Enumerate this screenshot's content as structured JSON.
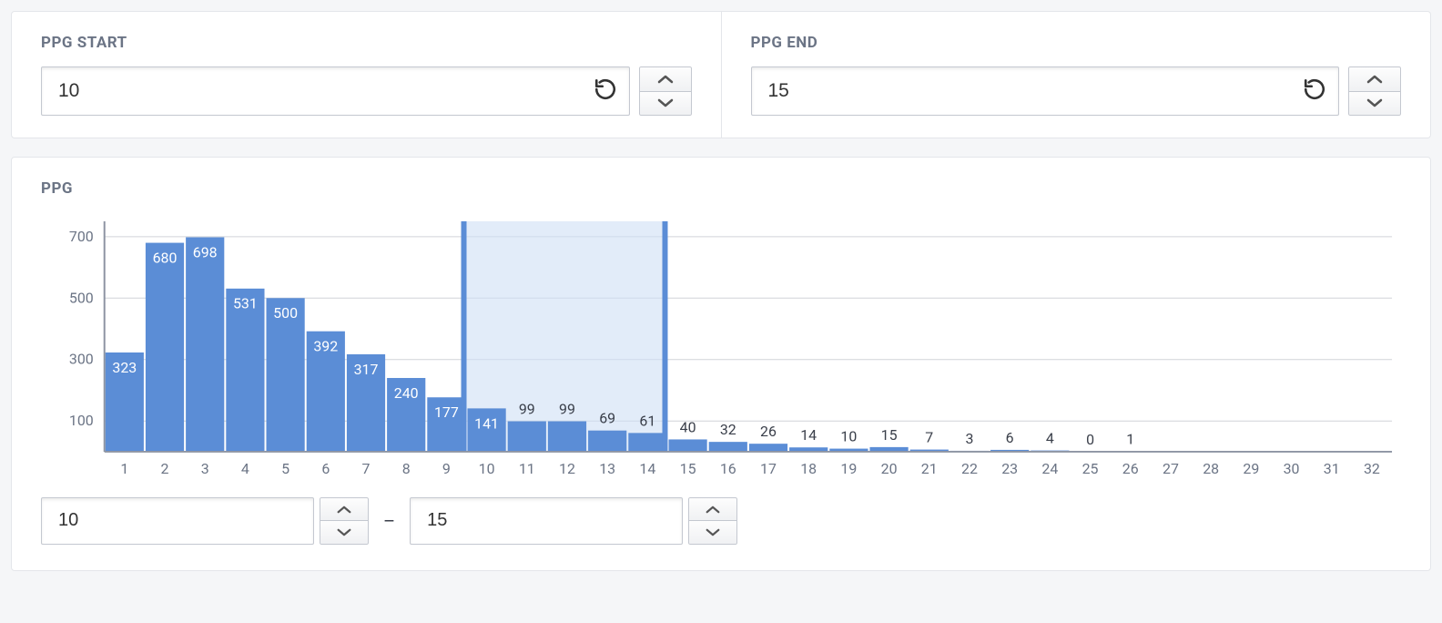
{
  "ppg_start": {
    "label": "PPG START",
    "value": "10"
  },
  "ppg_end": {
    "label": "PPG END",
    "value": "15"
  },
  "chart": {
    "title": "PPG",
    "range_low": "10",
    "range_high": "15",
    "range_separator": "–"
  },
  "chart_data": {
    "type": "bar",
    "categories": [
      1,
      2,
      3,
      4,
      5,
      6,
      7,
      8,
      9,
      10,
      11,
      12,
      13,
      14,
      15,
      16,
      17,
      18,
      19,
      20,
      21,
      22,
      23,
      24,
      25,
      26,
      27,
      28,
      29,
      30,
      31,
      32
    ],
    "values": [
      323,
      680,
      698,
      531,
      500,
      392,
      317,
      240,
      177,
      141,
      99,
      99,
      69,
      61,
      40,
      32,
      26,
      14,
      10,
      15,
      7,
      3,
      6,
      4,
      0,
      1,
      null,
      null,
      null,
      null,
      null,
      null
    ],
    "yticks": [
      100,
      300,
      500,
      700
    ],
    "ylim": [
      0,
      750
    ],
    "selection": {
      "start": 10,
      "end": 15
    },
    "xlabel": "",
    "ylabel": "",
    "title": "PPG"
  }
}
